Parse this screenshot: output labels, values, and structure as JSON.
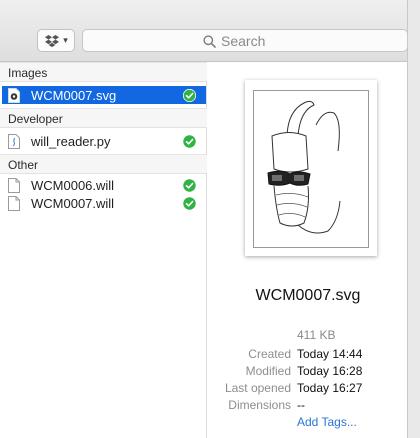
{
  "toolbar": {
    "dropbox_icon": "dropbox-icon",
    "search_placeholder": "Search"
  },
  "groups": [
    {
      "header": "Images",
      "items": [
        {
          "name": "WCM0007.svg",
          "icon": "svg-file-icon",
          "synced": true,
          "selected": true
        }
      ]
    },
    {
      "header": "Developer",
      "items": [
        {
          "name": "will_reader.py",
          "icon": "python-file-icon",
          "synced": true,
          "selected": false
        }
      ]
    },
    {
      "header": "Other",
      "items": [
        {
          "name": "WCM0006.will",
          "icon": "document-icon",
          "synced": true,
          "selected": false
        },
        {
          "name": "WCM0007.will",
          "icon": "document-icon",
          "synced": true,
          "selected": false
        }
      ]
    }
  ],
  "preview": {
    "title": "WCM0007.svg",
    "size": "411 KB",
    "created_label": "Created",
    "created_value": "Today 14:44",
    "modified_label": "Modified",
    "modified_value": "Today 16:28",
    "opened_label": "Last opened",
    "opened_value": "Today 16:27",
    "dimensions_label": "Dimensions",
    "dimensions_value": "--",
    "add_tags": "Add Tags..."
  },
  "colors": {
    "selection": "#1268e0",
    "sync_check": "#2fb343",
    "link": "#2a74d6"
  }
}
